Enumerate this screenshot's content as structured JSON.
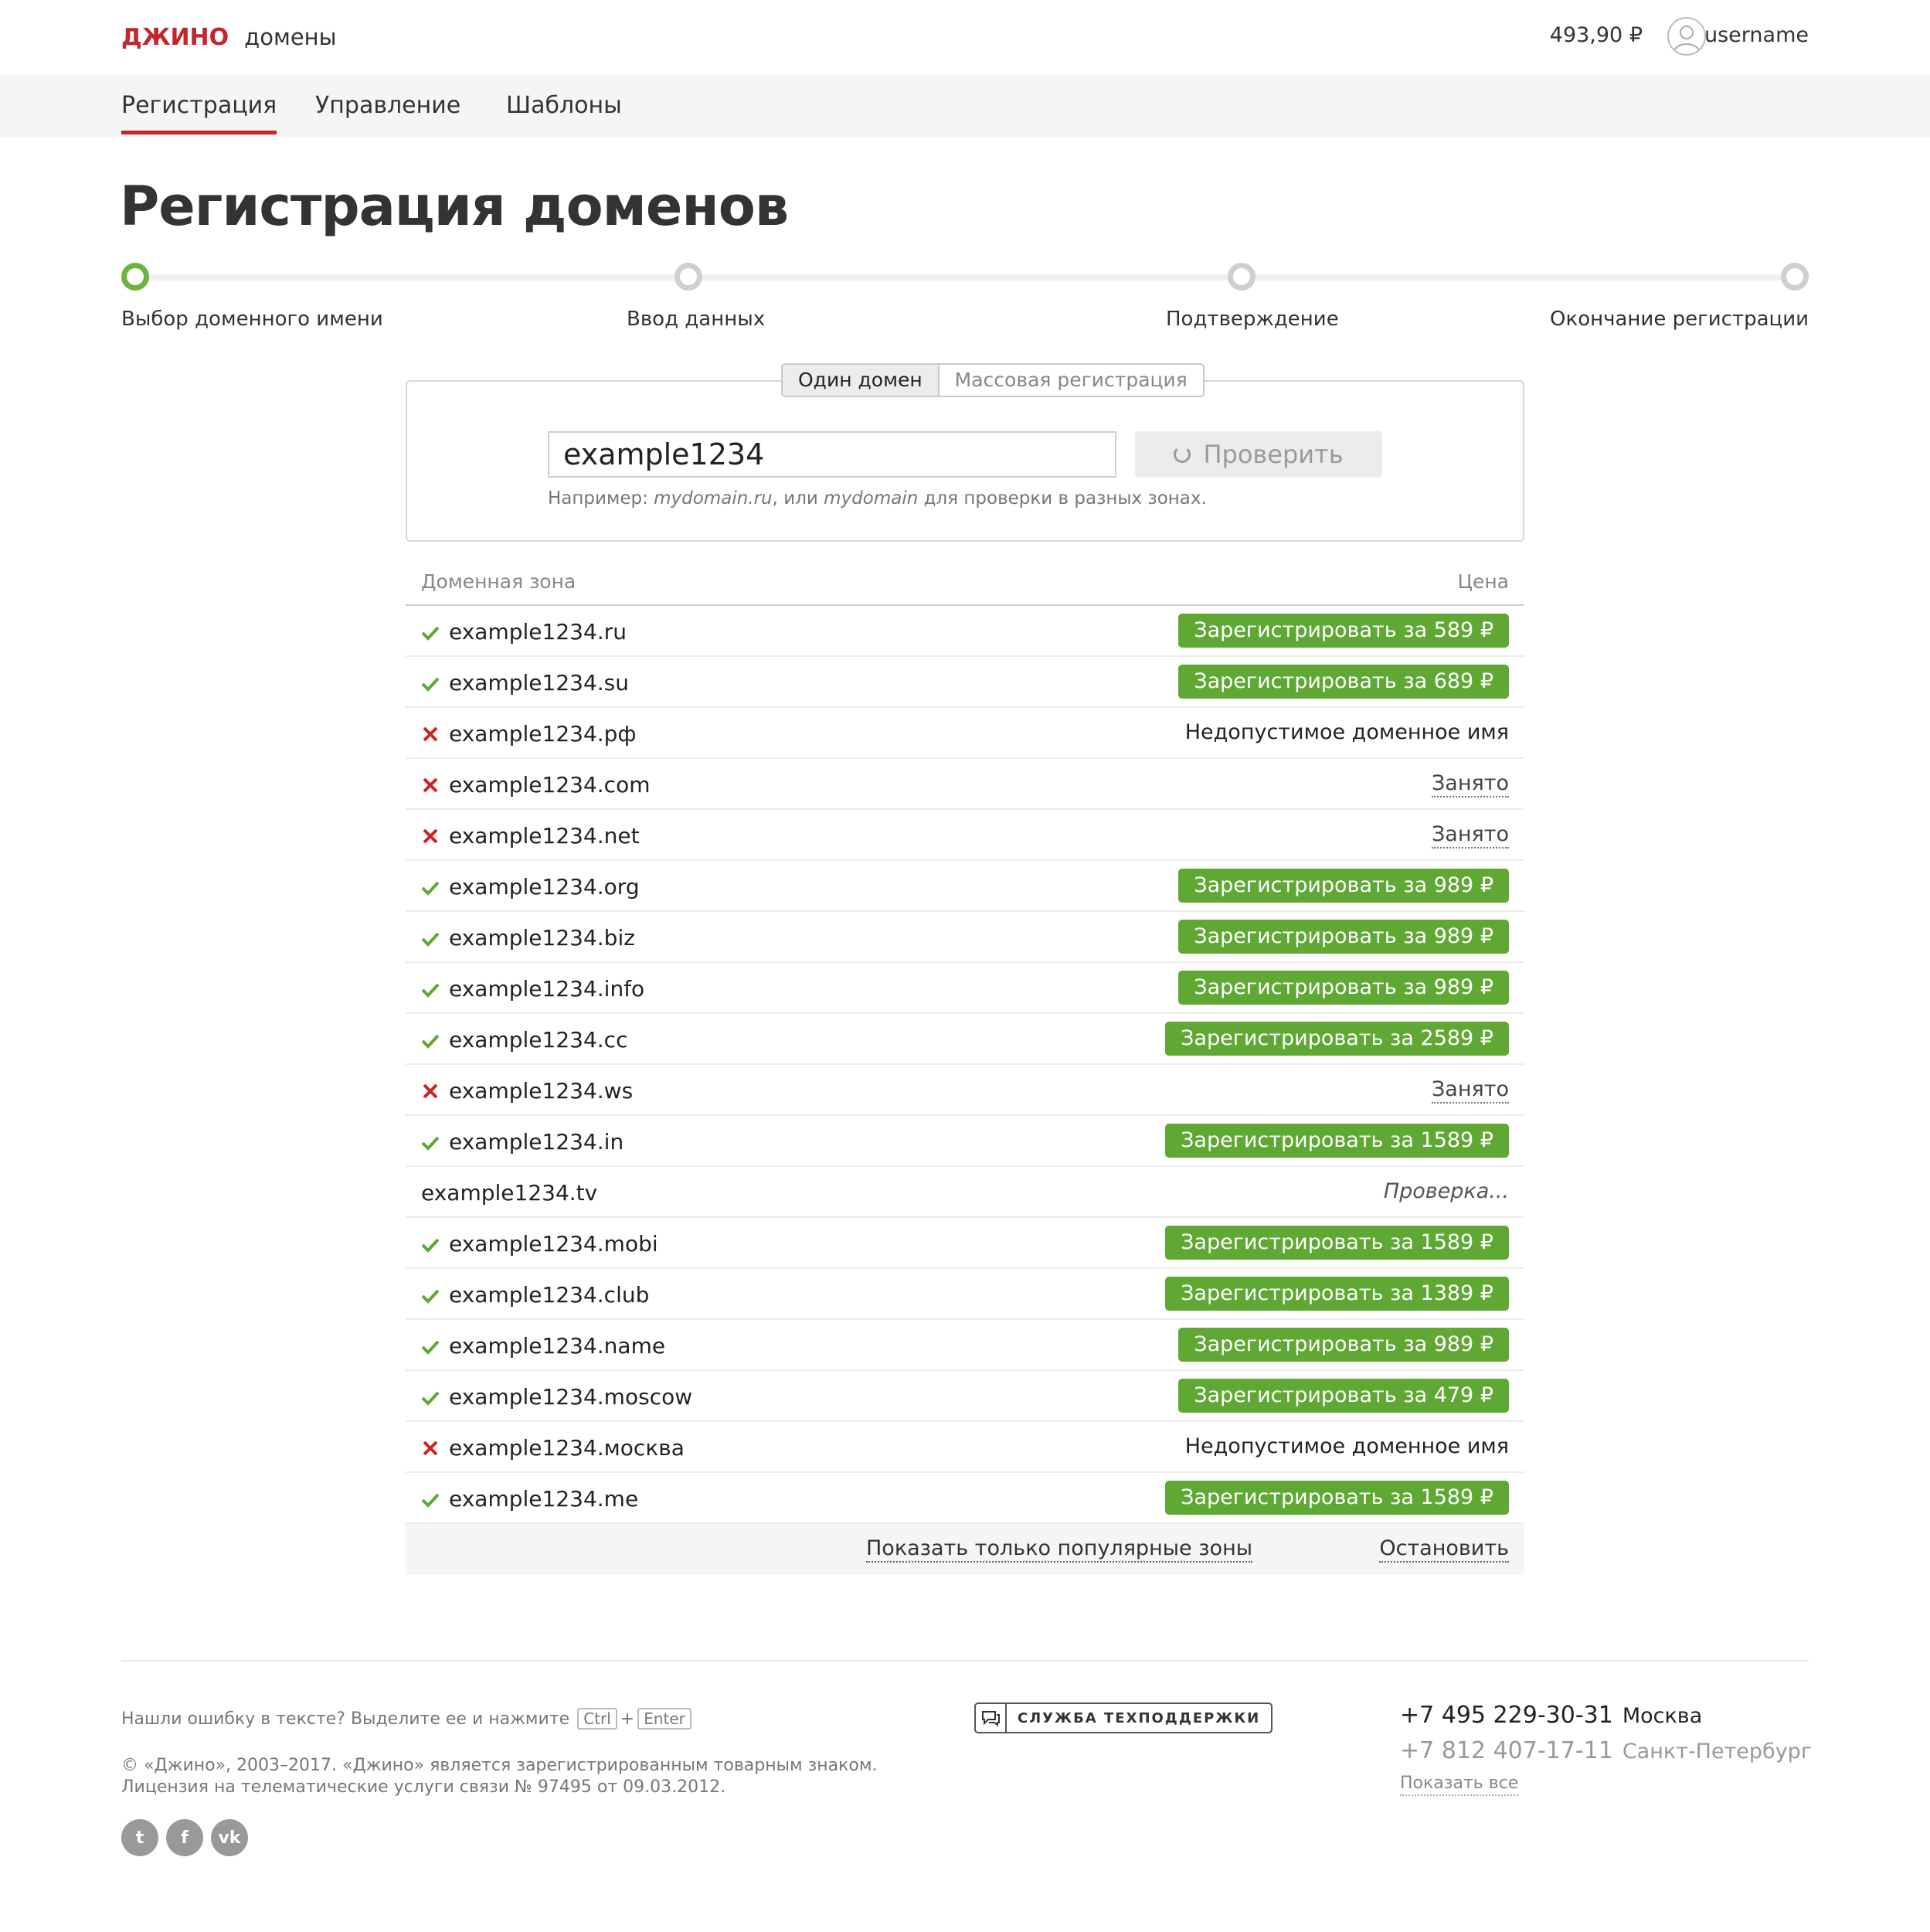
{
  "header": {
    "logo": "ДЖИНО",
    "logo_sub": "домены",
    "balance": "493,90 ₽",
    "username": "username"
  },
  "nav": {
    "items": [
      {
        "label": "Регистрация",
        "active": true
      },
      {
        "label": "Управление",
        "active": false
      },
      {
        "label": "Шаблоны",
        "active": false
      }
    ]
  },
  "page_title": "Регистрация доменов",
  "steps": [
    {
      "label": "Выбор доменного имени",
      "active": true
    },
    {
      "label": "Ввод данных",
      "active": false
    },
    {
      "label": "Подтверждение",
      "active": false
    },
    {
      "label": "Окончание регистрации",
      "active": false
    }
  ],
  "search": {
    "mode_single": "Один домен",
    "mode_bulk": "Массовая регистрация",
    "value": "example1234",
    "check_label": "Проверить",
    "hint_prefix": "Например: ",
    "hint_example1": "mydomain.ru",
    "hint_mid": ", или ",
    "hint_example2": "mydomain",
    "hint_suffix": " для проверки в разных зонах."
  },
  "results": {
    "col_zone": "Доменная зона",
    "col_price": "Цена",
    "rows": [
      {
        "domain": "example1234.ru",
        "status": "available",
        "action": "Зарегистрировать за 589 ₽"
      },
      {
        "domain": "example1234.su",
        "status": "available",
        "action": "Зарегистрировать за 689 ₽"
      },
      {
        "domain": "example1234.рф",
        "status": "invalid",
        "action": "Недопустимое доменное имя"
      },
      {
        "domain": "example1234.com",
        "status": "taken",
        "action": "Занято"
      },
      {
        "domain": "example1234.net",
        "status": "taken",
        "action": "Занято"
      },
      {
        "domain": "example1234.org",
        "status": "available",
        "action": "Зарегистрировать за 989 ₽"
      },
      {
        "domain": "example1234.biz",
        "status": "available",
        "action": "Зарегистрировать за 989 ₽"
      },
      {
        "domain": "example1234.info",
        "status": "available",
        "action": "Зарегистрировать за 989 ₽"
      },
      {
        "domain": "example1234.cc",
        "status": "available",
        "action": "Зарегистрировать за 2589 ₽"
      },
      {
        "domain": "example1234.ws",
        "status": "taken",
        "action": "Занято"
      },
      {
        "domain": "example1234.in",
        "status": "available",
        "action": "Зарегистрировать за 1589 ₽"
      },
      {
        "domain": "example1234.tv",
        "status": "pending",
        "action": "Проверка..."
      },
      {
        "domain": "example1234.mobi",
        "status": "available",
        "action": "Зарегистрировать за 1589 ₽"
      },
      {
        "domain": "example1234.club",
        "status": "available",
        "action": "Зарегистрировать за 1389 ₽"
      },
      {
        "domain": "example1234.name",
        "status": "available",
        "action": "Зарегистрировать за 989 ₽"
      },
      {
        "domain": "example1234.moscow",
        "status": "available",
        "action": "Зарегистрировать за 479 ₽"
      },
      {
        "domain": "example1234.москва",
        "status": "invalid",
        "action": "Недопустимое доменное имя"
      },
      {
        "domain": "example1234.me",
        "status": "available",
        "action": "Зарегистрировать за 1589 ₽"
      }
    ],
    "show_popular": "Показать только популярные зоны",
    "stop": "Остановить"
  },
  "footer": {
    "error_hint": "Нашли ошибку в тексте? Выделите ее и нажмите",
    "key_ctrl": "Ctrl",
    "key_plus": "+",
    "key_enter": "Enter",
    "support": "СЛУЖБА ТЕХПОДДЕРЖКИ",
    "copyright_line1": "© «Джино», 2003–2017. «Джино» является зарегистрированным товарным знаком.",
    "copyright_line2": "Лицензия на телематические услуги связи № 97495 от 09.03.2012.",
    "phone1": "+7 495 229-30-31",
    "city1": "Москва",
    "phone2": "+7 812 407-17-11",
    "city2": "Санкт-Петербург",
    "show_all": "Показать все",
    "socials": [
      {
        "name": "twitter-icon",
        "glyph": "t"
      },
      {
        "name": "facebook-icon",
        "glyph": "f"
      },
      {
        "name": "vk-icon",
        "glyph": "vk"
      }
    ]
  },
  "colors": {
    "brand": "#c1272d",
    "available": "#5fa833",
    "error": "#d0201f"
  }
}
